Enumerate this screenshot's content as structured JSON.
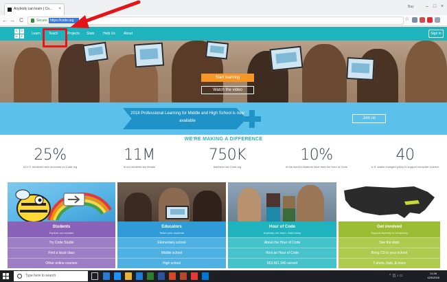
{
  "browser": {
    "tab_title": "Anybody can learn | Co...",
    "tab_close": "×",
    "profile": "Bay",
    "window_controls": [
      "–",
      "□",
      "×"
    ],
    "nav": {
      "back": "←",
      "forward": "→",
      "reload": "C"
    },
    "secure_label": "Secure",
    "url": "https://code.org",
    "star": "☆"
  },
  "site": {
    "logo_letters": [
      "C",
      "O",
      "D",
      "E"
    ],
    "nav": [
      "Learn",
      "Teach",
      "Projects",
      "Stats",
      "Help Us",
      "About"
    ],
    "sign_in": "Sign in",
    "hero_primary": "Start learning",
    "hero_secondary": "Watch the video",
    "banner_text": "2018 Professional Learning for Middle and High School is now available",
    "banner_button": "Join us",
    "difference_heading": "WE'RE MAKING A DIFFERENCE",
    "stats": [
      {
        "value": "25%",
        "caption": "of U.S. students have accounts on Code.org"
      },
      {
        "value": "11M",
        "caption": "of our students are female"
      },
      {
        "value": "750K",
        "caption": "teachers use Code.org"
      },
      {
        "value": "10%",
        "caption": "of the world's students have tried the Hour of Code"
      },
      {
        "value": "40",
        "caption": "U.S. states changed policy to support computer science"
      }
    ],
    "cards": [
      {
        "title": "Students",
        "subtitle": "Explore our courses",
        "color": "#8a63b8",
        "links": [
          "Try Code Studio",
          "Find a local class",
          "Other online courses"
        ]
      },
      {
        "title": "Educators",
        "subtitle": "Teach your students",
        "color": "#2f9bd7",
        "links": [
          "Elementary school",
          "Middle school",
          "High school"
        ]
      },
      {
        "title": "Hour of Code",
        "subtitle": "Anybody can learn. Start today",
        "color": "#1fb3be",
        "links": [
          "About the Hour of Code",
          "Host an Hour of Code",
          "553,661,540 served"
        ]
      },
      {
        "title": "Get involved",
        "subtitle": "Support diversity in computing",
        "color": "#9bbd33",
        "links": [
          "See the stats",
          "Bring CS to your school",
          "T-shirts, hats, & more"
        ]
      }
    ]
  },
  "taskbar": {
    "search_placeholder": "Type here to search",
    "clock_time": "11:28",
    "clock_date": "12/6/2018"
  },
  "colors": {
    "teal": "#1fb3be",
    "banner": "#5bc1ea",
    "orange": "#f79624",
    "annotation_red": "#e4141b"
  }
}
